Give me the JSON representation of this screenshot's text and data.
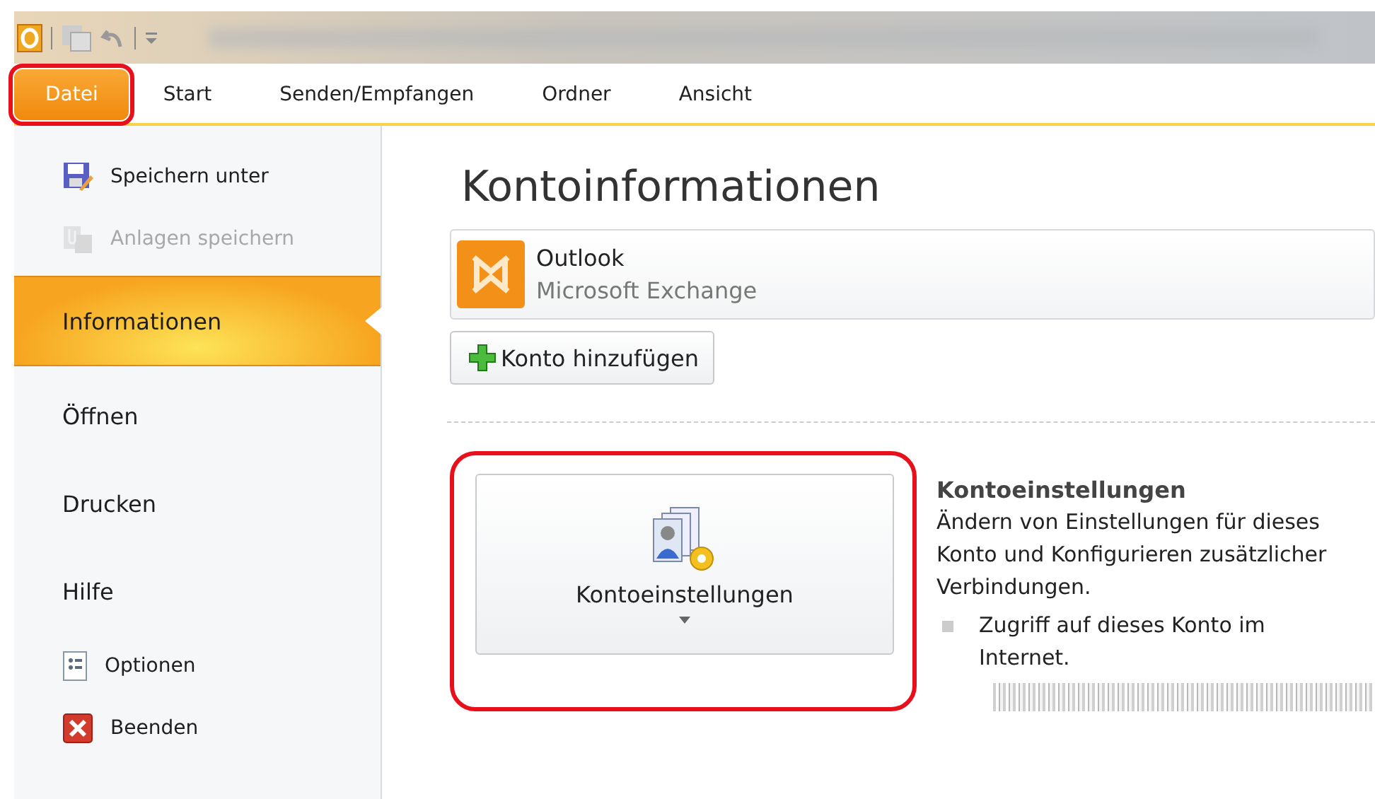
{
  "ribbon_tabs": [
    {
      "label": "Datei",
      "selected": true,
      "highlighted": true
    },
    {
      "label": "Start",
      "selected": false,
      "highlighted": false
    },
    {
      "label": "Senden/Empfangen",
      "selected": false,
      "highlighted": false
    },
    {
      "label": "Ordner",
      "selected": false,
      "highlighted": false
    },
    {
      "label": "Ansicht",
      "selected": false,
      "highlighted": false
    }
  ],
  "sidebar": {
    "items": [
      {
        "label": "Speichern unter",
        "kind": "saveas",
        "selected": false,
        "disabled": false
      },
      {
        "label": "Anlagen speichern",
        "kind": "attachments",
        "selected": false,
        "disabled": true
      },
      {
        "label": "Informationen",
        "kind": "page",
        "selected": true,
        "disabled": false
      },
      {
        "label": "Öffnen",
        "kind": "page",
        "selected": false,
        "disabled": false
      },
      {
        "label": "Drucken",
        "kind": "page",
        "selected": false,
        "disabled": false
      },
      {
        "label": "Hilfe",
        "kind": "page",
        "selected": false,
        "disabled": false
      },
      {
        "label": "Optionen",
        "kind": "options",
        "selected": false,
        "disabled": false
      },
      {
        "label": "Beenden",
        "kind": "exit",
        "selected": false,
        "disabled": false
      }
    ]
  },
  "content": {
    "heading": "Kontoinformationen",
    "account": {
      "name": "Outlook",
      "type": "Microsoft Exchange"
    },
    "add_account_button": "Konto hinzufügen",
    "settings_button": {
      "label": "Kontoeinstellungen",
      "highlighted": true
    },
    "settings_title": "Kontoeinstellungen",
    "settings_description": "Ändern von Einstellungen für dieses Konto und Konfigurieren zusätzlicher Verbindungen.",
    "bullets": [
      "Zugriff auf dieses Konto im Internet."
    ]
  }
}
